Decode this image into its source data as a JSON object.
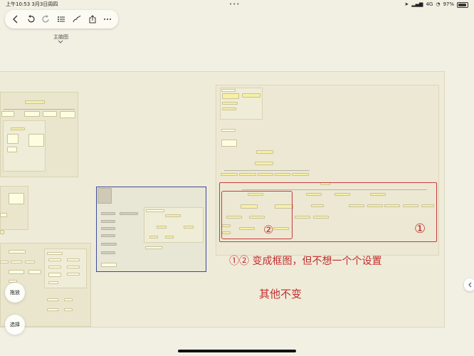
{
  "status": {
    "time": "上午10:53",
    "date": "3月3日周四",
    "signal": "4G",
    "battery": "97%",
    "battery_level": 0.97
  },
  "toolbar": {
    "icons": [
      "back-icon",
      "undo-icon",
      "redo-icon",
      "outline-icon",
      "pen-icon",
      "share-icon",
      "more-icon"
    ]
  },
  "map": {
    "title": "主脑图"
  },
  "annotation": {
    "circle_one": "①",
    "circle_two": "②",
    "line1": "①② 变成框图，但不想一个个设置",
    "line2": "其他不变"
  },
  "buttons": {
    "drag": "拖放",
    "select": "选择"
  },
  "colors": {
    "annotation": "#c73b3b",
    "selected_frame": "#3c4a96",
    "node_highlight": "#f7f0a4"
  }
}
